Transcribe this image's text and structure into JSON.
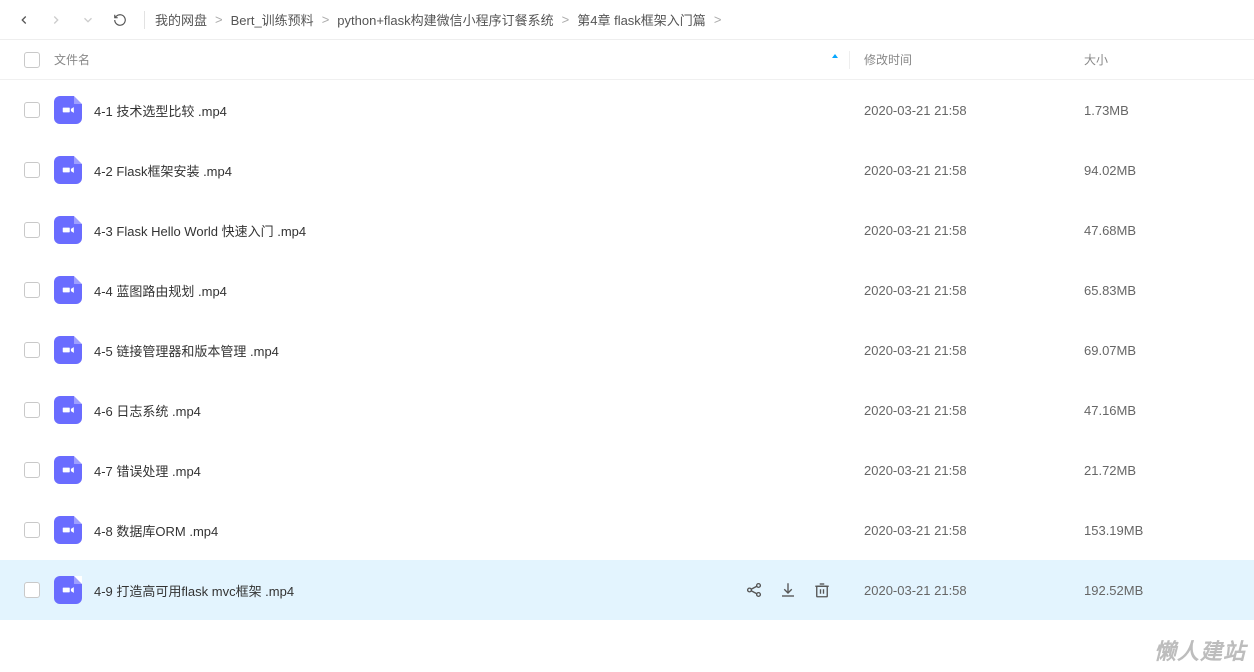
{
  "breadcrumb": {
    "items": [
      {
        "label": "我的网盘"
      },
      {
        "label": "Bert_训练预料"
      },
      {
        "label": "python+flask构建微信小程序订餐系统"
      },
      {
        "label": "第4章 flask框架入门篇"
      }
    ]
  },
  "columns": {
    "name": "文件名",
    "date": "修改时间",
    "size": "大小"
  },
  "files": [
    {
      "name": "4-1 技术选型比较 .mp4",
      "date": "2020-03-21 21:58",
      "size": "1.73MB",
      "selected": false
    },
    {
      "name": "4-2 Flask框架安装 .mp4",
      "date": "2020-03-21 21:58",
      "size": "94.02MB",
      "selected": false
    },
    {
      "name": "4-3 Flask Hello World 快速入门  .mp4",
      "date": "2020-03-21 21:58",
      "size": "47.68MB",
      "selected": false
    },
    {
      "name": "4-4 蓝图路由规划  .mp4",
      "date": "2020-03-21 21:58",
      "size": "65.83MB",
      "selected": false
    },
    {
      "name": "4-5 链接管理器和版本管理  .mp4",
      "date": "2020-03-21 21:58",
      "size": "69.07MB",
      "selected": false
    },
    {
      "name": "4-6 日志系统  .mp4",
      "date": "2020-03-21 21:58",
      "size": "47.16MB",
      "selected": false
    },
    {
      "name": "4-7 错误处理 .mp4",
      "date": "2020-03-21 21:58",
      "size": "21.72MB",
      "selected": false
    },
    {
      "name": "4-8 数据库ORM .mp4",
      "date": "2020-03-21 21:58",
      "size": "153.19MB",
      "selected": false
    },
    {
      "name": "4-9 打造高可用flask mvc框架 .mp4",
      "date": "2020-03-21 21:58",
      "size": "192.52MB",
      "selected": true
    }
  ],
  "watermark": "懒人建站"
}
